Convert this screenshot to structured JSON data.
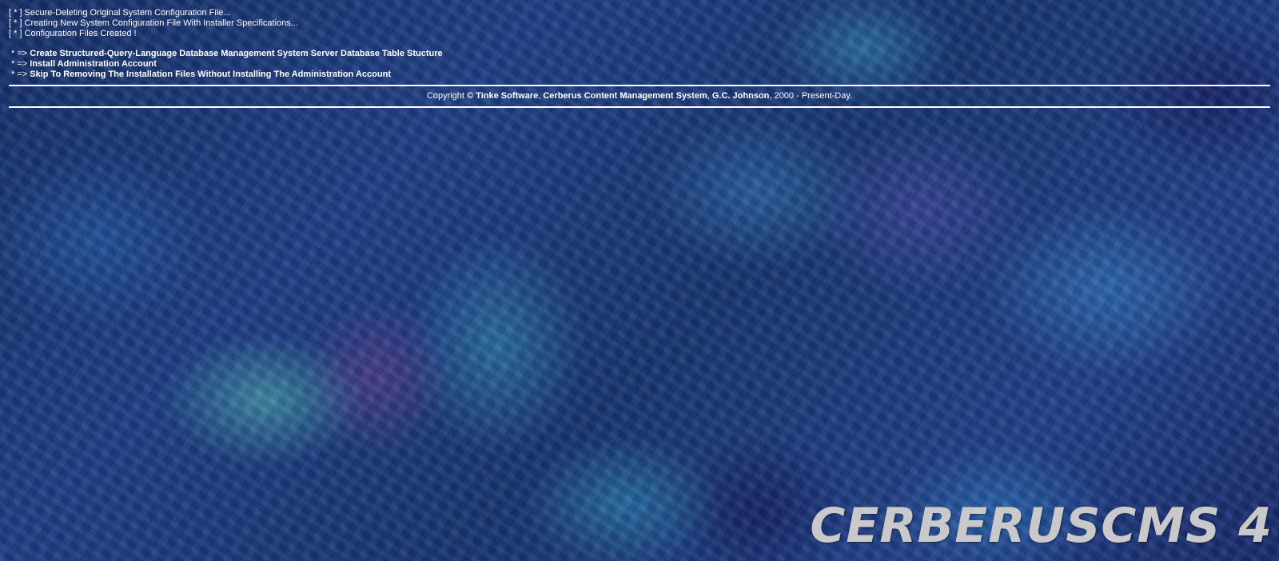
{
  "log": [
    "[ * ] Secure-Deleting Original System Configuration File...",
    "[ * ] Creating New System Configuration File With Installer Specifications...",
    "[ * ] Configuration Files Created !"
  ],
  "menu": {
    "prefix": "* => ",
    "items": [
      "Create Structured-Query-Language Database Management System Server Database Table Stucture",
      "Install Administration Account",
      "Skip To Removing The Installation Files Without Installing The Administration Account"
    ]
  },
  "footer": {
    "copyright_word": "Copyright ",
    "company": "© Tinke Software",
    "sep1": ", ",
    "product": "Cerberus Content Management System",
    "sep2": ", ",
    "author": "G.C. Johnson",
    "years": ", 2000 - Present-Day."
  },
  "logo": {
    "text": "CERBERUSCMS 4"
  },
  "colors": {
    "text": "#ffffff",
    "logo": "#c9c9cc",
    "background": "#1b2f6e"
  }
}
